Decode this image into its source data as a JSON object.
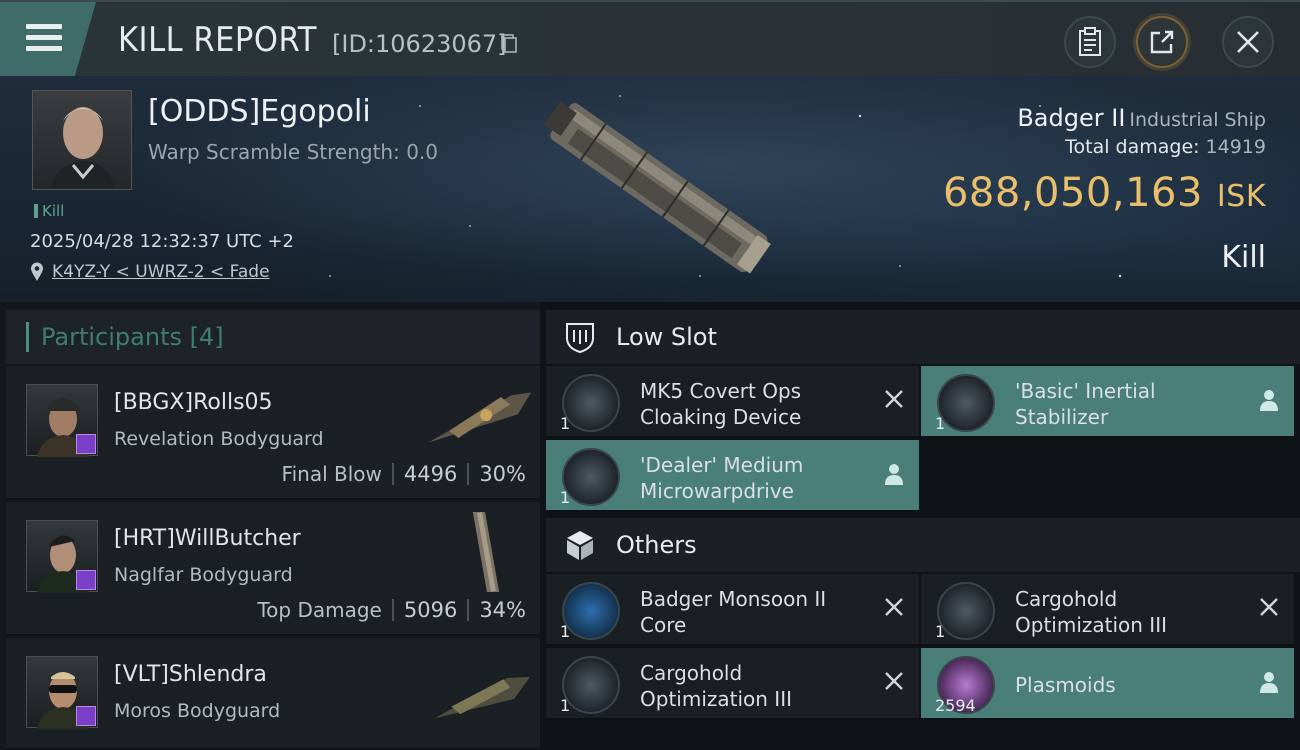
{
  "header": {
    "title": "KILL REPORT",
    "report_id": "[ID:10623067]",
    "icons": [
      "menu-icon",
      "copy-icon",
      "clipboard-icon",
      "share-icon",
      "close-icon"
    ]
  },
  "victim": {
    "name": "[ODDS]Egopoli",
    "warp_scramble": "Warp Scramble Strength: 0.0",
    "kill_label_small": "Kill",
    "timestamp": "2025/04/28 12:32:37 UTC +2",
    "location": "K4YZ-Y < UWRZ-2 < Fade",
    "ship_name": "Badger II",
    "ship_class": "Industrial Ship",
    "total_damage_label": "Total damage:",
    "total_damage_value": "14919",
    "isk_value": "688,050,163",
    "isk_unit": "ISK",
    "result": "Kill"
  },
  "participants": {
    "label": "Participants",
    "count": "[4]",
    "rows": [
      {
        "name": "[BBGX]Rolls05",
        "ship": "Revelation Bodyguard",
        "tag": "Final Blow",
        "damage": "4496",
        "percent": "30%"
      },
      {
        "name": "[HRT]WillButcher",
        "ship": "Naglfar Bodyguard",
        "tag": "Top Damage",
        "damage": "5096",
        "percent": "34%"
      },
      {
        "name": "[VLT]Shlendra",
        "ship": "Moros Bodyguard",
        "tag": "",
        "damage": "",
        "percent": ""
      }
    ]
  },
  "low_slot": {
    "label": "Low Slot",
    "items": [
      {
        "name_line1": "MK5 Covert Ops",
        "name_line2": "Cloaking Device",
        "qty": "1",
        "state": "destroyed"
      },
      {
        "name_line1": "'Basic' Inertial",
        "name_line2": "Stabilizer",
        "qty": "1",
        "state": "dropped"
      },
      {
        "name_line1": "'Dealer' Medium",
        "name_line2": "Microwarpdrive",
        "qty": "1",
        "state": "dropped"
      }
    ]
  },
  "others": {
    "label": "Others",
    "items": [
      {
        "name_line1": "Badger Monsoon II",
        "name_line2": "Core",
        "qty": "1",
        "state": "destroyed"
      },
      {
        "name_line1": "Cargohold",
        "name_line2": "Optimization III",
        "qty": "1",
        "state": "destroyed"
      },
      {
        "name_line1": "Cargohold",
        "name_line2": "Optimization III",
        "qty": "1",
        "state": "destroyed"
      },
      {
        "name_line1": "Plasmoids",
        "name_line2": "",
        "qty": "2594",
        "state": "dropped"
      }
    ]
  },
  "colors": {
    "accent_teal": "#4a7f79",
    "isk_gold": "#e9bf6b",
    "badge_purple": "#7a3fc6"
  }
}
